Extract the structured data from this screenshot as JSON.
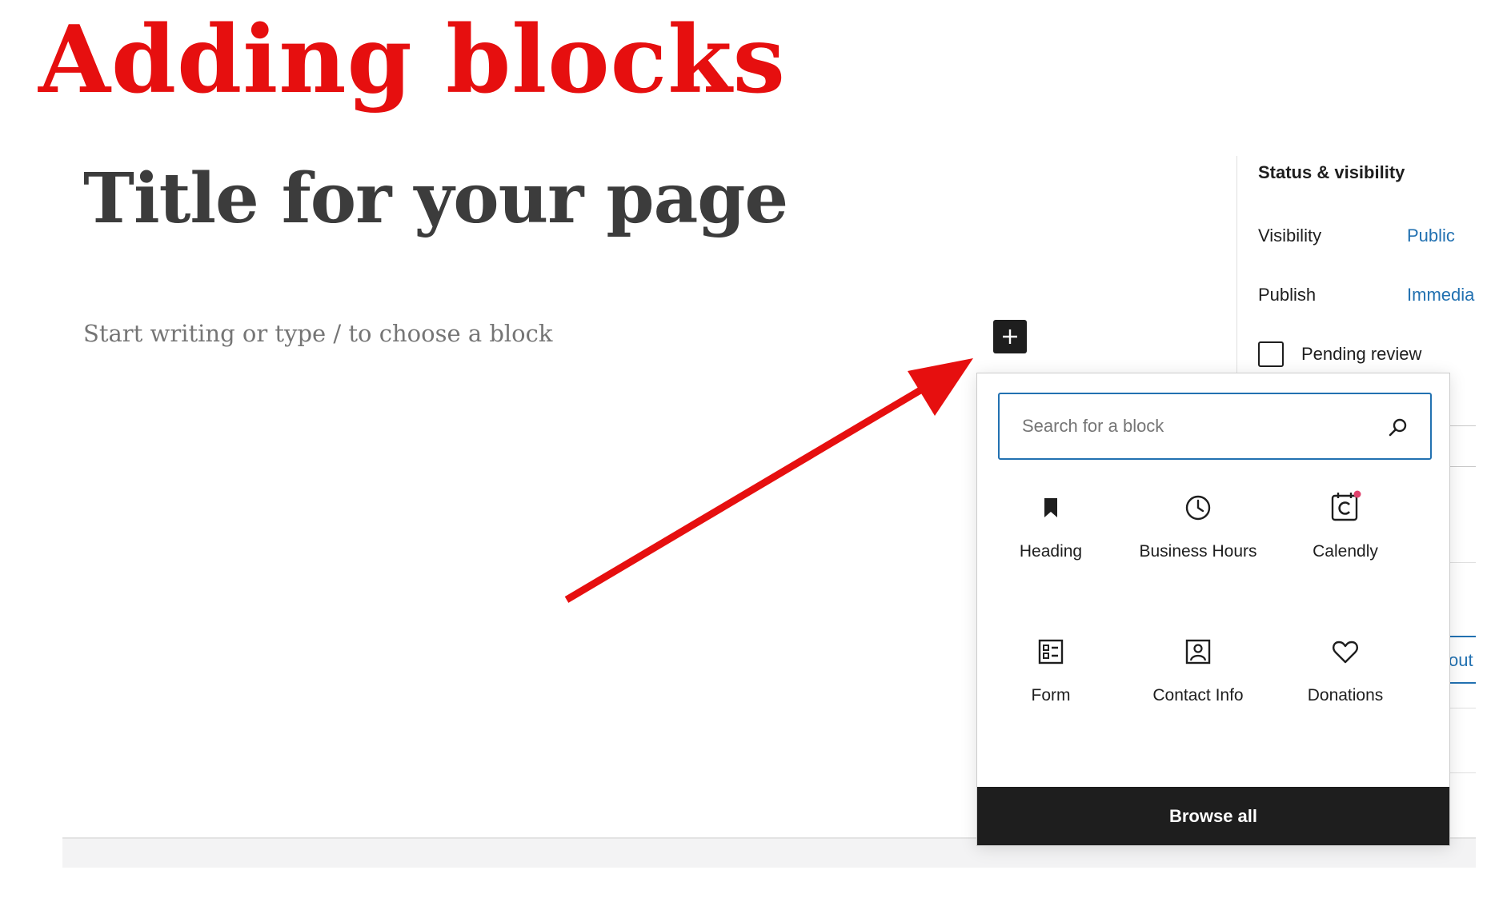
{
  "annotation": {
    "heading": "Adding blocks"
  },
  "editor": {
    "title": "Title for your page",
    "placeholder": "Start writing or type / to choose a block"
  },
  "sidebar": {
    "section_title": "Status & visibility",
    "visibility_label": "Visibility",
    "visibility_value": "Public",
    "publish_label": "Publish",
    "publish_value": "Immedia",
    "pending_review_label": "Pending review",
    "partial_link": "out"
  },
  "inserter": {
    "search_placeholder": "Search for a block",
    "blocks": [
      {
        "label": "Heading",
        "icon": "bookmark-icon"
      },
      {
        "label": "Business Hours",
        "icon": "clock-icon"
      },
      {
        "label": "Calendly",
        "icon": "calendly-icon"
      },
      {
        "label": "Form",
        "icon": "form-icon"
      },
      {
        "label": "Contact Info",
        "icon": "contact-info-icon"
      },
      {
        "label": "Donations",
        "icon": "heart-icon"
      }
    ],
    "browse_all": "Browse all"
  },
  "colors": {
    "annotation_red": "#e60f0f",
    "link_blue": "#2271b1",
    "dark": "#1e1e1e",
    "calendly_dot": "#e0426d"
  }
}
